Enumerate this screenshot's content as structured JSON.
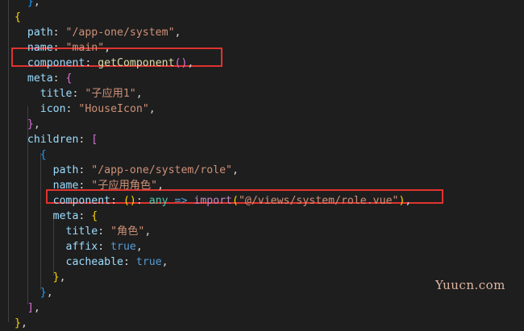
{
  "code": {
    "lines": [
      [
        {
          "t": "  ",
          "c": "c"
        },
        {
          "t": "}",
          "c": "b2"
        },
        {
          "t": ",",
          "c": "c"
        }
      ],
      [
        {
          "t": "{",
          "c": "b3"
        }
      ],
      [
        {
          "t": "  path",
          "c": "k"
        },
        {
          "t": ": ",
          "c": "c"
        },
        {
          "t": "\"/app-one/system\"",
          "c": "s"
        },
        {
          "t": ",",
          "c": "c"
        }
      ],
      [
        {
          "t": "  name",
          "c": "k"
        },
        {
          "t": ": ",
          "c": "c"
        },
        {
          "t": "\"main\"",
          "c": "s"
        },
        {
          "t": ",",
          "c": "c"
        }
      ],
      [
        {
          "t": "  component",
          "c": "k"
        },
        {
          "t": ": ",
          "c": "c"
        },
        {
          "t": "getComponent",
          "c": "f"
        },
        {
          "t": "()",
          "c": "b1"
        },
        {
          "t": ",",
          "c": "c"
        }
      ],
      [
        {
          "t": "  meta",
          "c": "k"
        },
        {
          "t": ": ",
          "c": "c"
        },
        {
          "t": "{",
          "c": "b1"
        }
      ],
      [
        {
          "t": "    title",
          "c": "k"
        },
        {
          "t": ": ",
          "c": "c"
        },
        {
          "t": "\"子应用1\"",
          "c": "s"
        },
        {
          "t": ",",
          "c": "c"
        }
      ],
      [
        {
          "t": "    icon",
          "c": "k"
        },
        {
          "t": ": ",
          "c": "c"
        },
        {
          "t": "\"HouseIcon\"",
          "c": "s"
        },
        {
          "t": ",",
          "c": "c"
        }
      ],
      [
        {
          "t": "  ",
          "c": "c"
        },
        {
          "t": "}",
          "c": "b1"
        },
        {
          "t": ",",
          "c": "c"
        }
      ],
      [
        {
          "t": "  children",
          "c": "k"
        },
        {
          "t": ": ",
          "c": "c"
        },
        {
          "t": "[",
          "c": "b1"
        }
      ],
      [
        {
          "t": "    ",
          "c": "c"
        },
        {
          "t": "{",
          "c": "b2"
        }
      ],
      [
        {
          "t": "      path",
          "c": "k"
        },
        {
          "t": ": ",
          "c": "c"
        },
        {
          "t": "\"/app-one/system/role\"",
          "c": "s"
        },
        {
          "t": ",",
          "c": "c"
        }
      ],
      [
        {
          "t": "      name",
          "c": "k"
        },
        {
          "t": ": ",
          "c": "c"
        },
        {
          "t": "\"子应用角色\"",
          "c": "s"
        },
        {
          "t": ",",
          "c": "c"
        }
      ],
      [
        {
          "t": "      component",
          "c": "k"
        },
        {
          "t": ": ",
          "c": "c"
        },
        {
          "t": "()",
          "c": "b3"
        },
        {
          "t": ": ",
          "c": "c"
        },
        {
          "t": "any",
          "c": "ty"
        },
        {
          "t": " => ",
          "c": "kw"
        },
        {
          "t": "import",
          "c": "imp"
        },
        {
          "t": "(",
          "c": "b3"
        },
        {
          "t": "\"@/views/system/role.vue\"",
          "c": "s"
        },
        {
          "t": ")",
          "c": "b3"
        },
        {
          "t": ",",
          "c": "c"
        }
      ],
      [
        {
          "t": "      meta",
          "c": "k"
        },
        {
          "t": ": ",
          "c": "c"
        },
        {
          "t": "{",
          "c": "b3"
        }
      ],
      [
        {
          "t": "        title",
          "c": "k"
        },
        {
          "t": ": ",
          "c": "c"
        },
        {
          "t": "\"角色\"",
          "c": "s"
        },
        {
          "t": ",",
          "c": "c"
        }
      ],
      [
        {
          "t": "        affix",
          "c": "k"
        },
        {
          "t": ": ",
          "c": "c"
        },
        {
          "t": "true",
          "c": "kw"
        },
        {
          "t": ",",
          "c": "c"
        }
      ],
      [
        {
          "t": "        cacheable",
          "c": "k"
        },
        {
          "t": ": ",
          "c": "c"
        },
        {
          "t": "true",
          "c": "kw"
        },
        {
          "t": ",",
          "c": "c"
        }
      ],
      [
        {
          "t": "      ",
          "c": "c"
        },
        {
          "t": "}",
          "c": "b3"
        },
        {
          "t": ",",
          "c": "c"
        }
      ],
      [
        {
          "t": "    ",
          "c": "c"
        },
        {
          "t": "}",
          "c": "b2"
        },
        {
          "t": ",",
          "c": "c"
        }
      ],
      [
        {
          "t": "  ",
          "c": "c"
        },
        {
          "t": "]",
          "c": "b1"
        },
        {
          "t": ",",
          "c": "c"
        }
      ],
      [
        {
          "t": "}",
          "c": "b3"
        },
        {
          "t": ",",
          "c": "c"
        }
      ]
    ]
  },
  "watermark": "Yuucn.com",
  "colors": {
    "background": "#1e1e1e",
    "highlight_border": "#e0332f"
  }
}
